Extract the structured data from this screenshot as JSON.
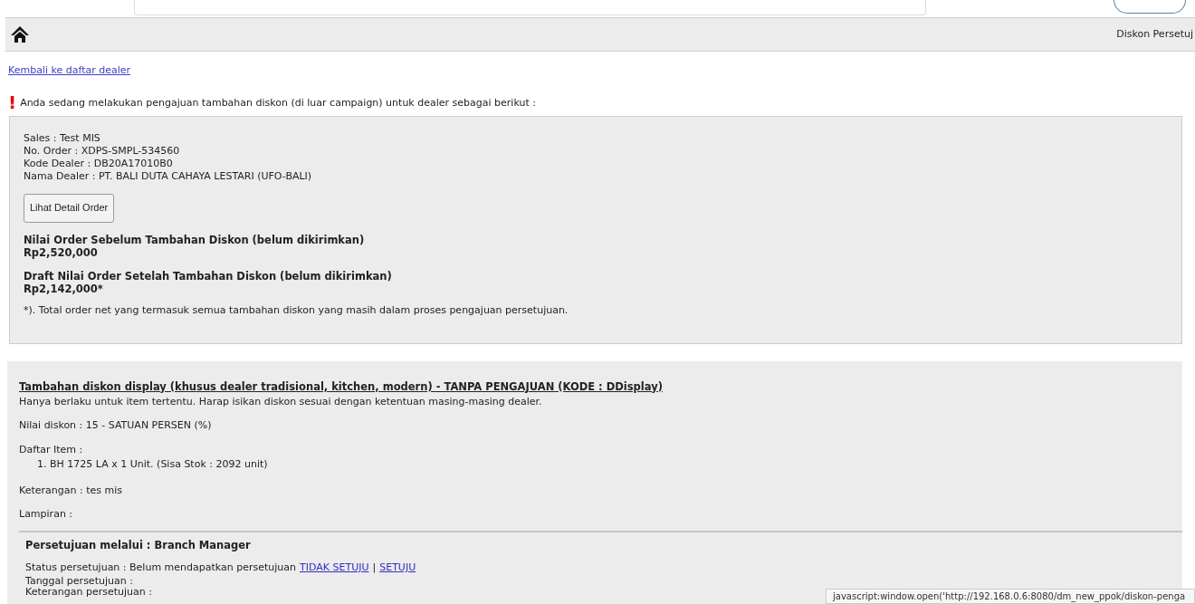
{
  "header": {
    "title": "Diskon Persetuj"
  },
  "back_link": "Kembali ke daftar dealer",
  "notice": {
    "icon": "!",
    "text": "Anda sedang melakukan pengajuan tambahan diskon (di luar campaign) untuk dealer sebagai berikut :"
  },
  "order": {
    "lines": [
      "Sales : Test MIS",
      "No. Order : XDPS-SMPL-534560",
      "Kode Dealer : DB20A17010B0",
      "Nama Dealer : PT. BALI DUTA CAHAYA LESTARI (UFO-BALI)"
    ],
    "button": "Lihat Detail Order",
    "totals": [
      {
        "label": "Nilai Order Sebelum Tambahan Diskon (belum dikirimkan)",
        "value": "Rp2,520,000"
      },
      {
        "label": "Draft Nilai Order Setelah Tambahan Diskon (belum dikirimkan)",
        "value": "Rp2,142,000*"
      }
    ],
    "footnote": "*). Total order net yang termasuk semua tambahan diskon yang masih dalam proses pengajuan persetujuan."
  },
  "discount": {
    "title": "Tambahan diskon display (khusus dealer tradisional, kitchen, modern) - TANPA PENGAJUAN (KODE : DDisplay)",
    "subtitle": "Hanya berlaku untuk item tertentu. Harap isikan diskon sesuai dengan ketentuan masing-masing dealer.",
    "value": "Nilai diskon : 15 - SATUAN PERSEN (%)",
    "items_label": "Daftar Item :",
    "items": [
      "1. BH 1725 LA x 1 Unit. (Sisa Stok : 2092 unit)"
    ],
    "note": "Keterangan : tes mis",
    "attachment": "Lampiran :",
    "approval": {
      "title": "Persetujuan melalui : Branch Manager",
      "status": "Status persetujuan : Belum mendapatkan persetujuan",
      "links": [
        "TIDAK SETUJU",
        "SETUJU"
      ],
      "separator": "|",
      "date": "Tanggal persetujuan :",
      "remark": "Keterangan persetujuan :"
    }
  },
  "status_bar": "javascript:window.open('http://192.168.0.6:8080/dm_new_ppok/diskon-penga"
}
